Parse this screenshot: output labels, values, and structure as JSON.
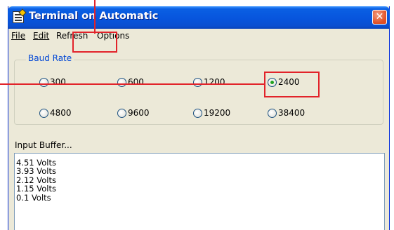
{
  "window": {
    "title": "Terminal on Automatic",
    "close_glyph": "✕"
  },
  "menu": [
    {
      "label": "File"
    },
    {
      "label": "Edit"
    },
    {
      "label": "Refresh"
    },
    {
      "label": "Options"
    }
  ],
  "baud_rate": {
    "group_label": "Baud Rate",
    "selected": "2400",
    "options": [
      "300",
      "600",
      "1200",
      "2400",
      "4800",
      "9600",
      "19200",
      "38400"
    ]
  },
  "input_buffer": {
    "label": "Input Buffer...",
    "lines": [
      "4.51 Volts",
      "3.93 Volts",
      "2.12 Volts",
      "1.15 Volts",
      "0.1 Volts"
    ]
  },
  "colors": {
    "annotation": "#e2232a",
    "titlebar": "#0755dd",
    "group_title": "#0046d5"
  }
}
